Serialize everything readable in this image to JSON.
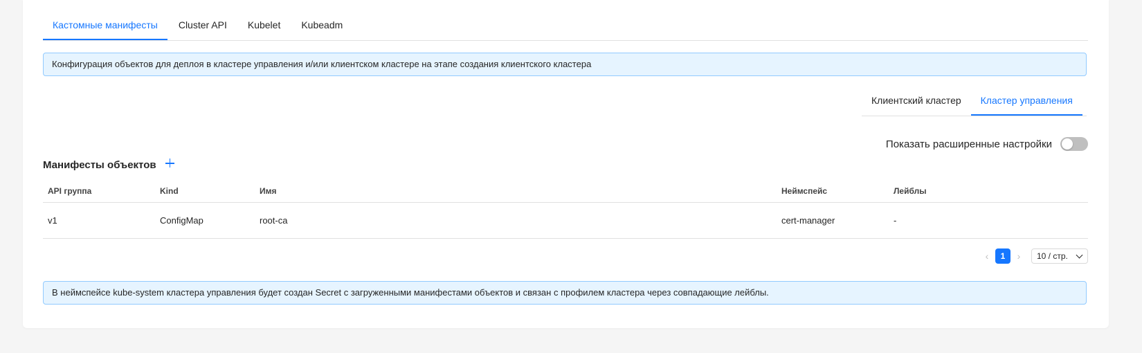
{
  "top_tabs": [
    {
      "label": "Кастомные манифесты",
      "active": true
    },
    {
      "label": "Cluster API",
      "active": false
    },
    {
      "label": "Kubelet",
      "active": false
    },
    {
      "label": "Kubeadm",
      "active": false
    }
  ],
  "info_alert": "Конфигурация объектов для деплоя в кластере управления и/или клиентском кластере на этапе создания клиентского кластера",
  "sub_tabs": [
    {
      "label": "Клиентский кластер",
      "active": false
    },
    {
      "label": "Кластер управления",
      "active": true
    }
  ],
  "advanced": {
    "label": "Показать расширенные настройки",
    "enabled": false
  },
  "manifests": {
    "title": "Манифесты объектов",
    "add_icon": "plus-icon",
    "columns": [
      "API группа",
      "Kind",
      "Имя",
      "Неймспейс",
      "Лейблы"
    ],
    "rows": [
      [
        "v1",
        "ConfigMap",
        "root-ca",
        "cert-manager",
        "-"
      ]
    ]
  },
  "pagination": {
    "prev_icon": "chevron-left-icon",
    "next_icon": "chevron-right-icon",
    "current_page": "1",
    "page_size": "10 / стр."
  },
  "bottom_alert": "В неймспейсе kube-system кластера управления будет создан Secret с загруженными манифестами объектов и связан с профилем кластера через совпадающие лейблы.",
  "colors": {
    "accent": "#1677ff",
    "alert_bg": "#e6f4ff",
    "alert_border": "#91caff"
  }
}
